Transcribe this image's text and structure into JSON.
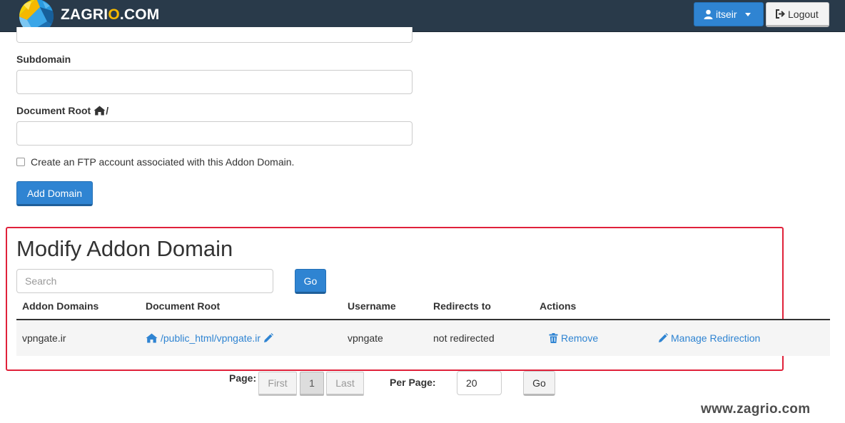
{
  "header": {
    "brand_prefix": "ZAGRI",
    "brand_accent": "O",
    "brand_suffix": ".COM",
    "user_label": "itseir",
    "logout_label": "Logout"
  },
  "form": {
    "subdomain_label": "Subdomain",
    "docroot_label": "Document Root",
    "docroot_suffix": "/",
    "ftp_label": "Create an FTP account associated with this Addon Domain.",
    "add_button": "Add Domain"
  },
  "modify": {
    "title": "Modify Addon Domain",
    "search_placeholder": "Search",
    "go_label": "Go",
    "columns": [
      "Addon Domains",
      "Document Root",
      "Username",
      "Redirects to",
      "Actions"
    ],
    "rows": [
      {
        "domain": "vpngate.ir",
        "docroot": "/public_html/vpngate.ir",
        "username": "vpngate",
        "redirects_to": "not redirected",
        "remove_label": "Remove",
        "manage_label": "Manage Redirection"
      }
    ]
  },
  "pagination": {
    "page_label": "Page:",
    "first_label": "First",
    "current_page": "1",
    "last_label": "Last",
    "per_page_label": "Per Page:",
    "per_page_value": "20",
    "go_label": "Go"
  },
  "watermark": "www.zagrio.com",
  "colors": {
    "topbar": "#293a4a",
    "primary": "#2f84d2",
    "highlight": "#e0213a",
    "brand_accent": "#f5b800"
  },
  "icons": {
    "user": "user-icon",
    "logout": "sign-out-icon",
    "home": "home-icon",
    "pencil": "pencil-icon",
    "trash": "trash-icon"
  }
}
